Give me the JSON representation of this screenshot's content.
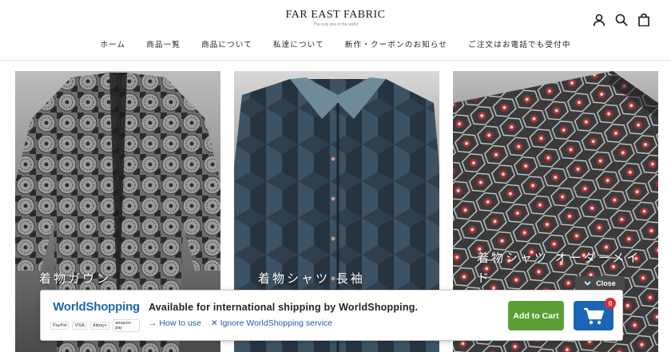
{
  "header": {
    "logo_title": "FAR EAST FABRIC",
    "logo_tagline": "The only one in the world",
    "nav": [
      {
        "label": "ホーム"
      },
      {
        "label": "商品一覧"
      },
      {
        "label": "商品について"
      },
      {
        "label": "私達について"
      },
      {
        "label": "新作・クーポンのお知らせ"
      },
      {
        "label": "ご注文はお電話でも受付中"
      }
    ],
    "icons": [
      "account-icon",
      "search-icon",
      "shopping-bag-icon"
    ]
  },
  "products": [
    {
      "title": "着物ガウン"
    },
    {
      "title": "着物シャツ 長袖"
    },
    {
      "title": "着物シャツ オーダーメイド"
    }
  ],
  "worldshopping": {
    "logo_text": "WorldShopping",
    "payments": [
      "PayPal",
      "VISA",
      "Alipay+",
      "amazon pay"
    ],
    "headline": "Available for international shipping by WorldShopping.",
    "how_to_use": "How to use",
    "ignore": "Ignore WorldShopping service",
    "add_to_cart": "Add to Cart",
    "cart_count": "0",
    "close_label": "Close",
    "colors": {
      "blue": "#1b64b5",
      "green": "#5b9e36",
      "badge": "#e02b2b"
    }
  }
}
